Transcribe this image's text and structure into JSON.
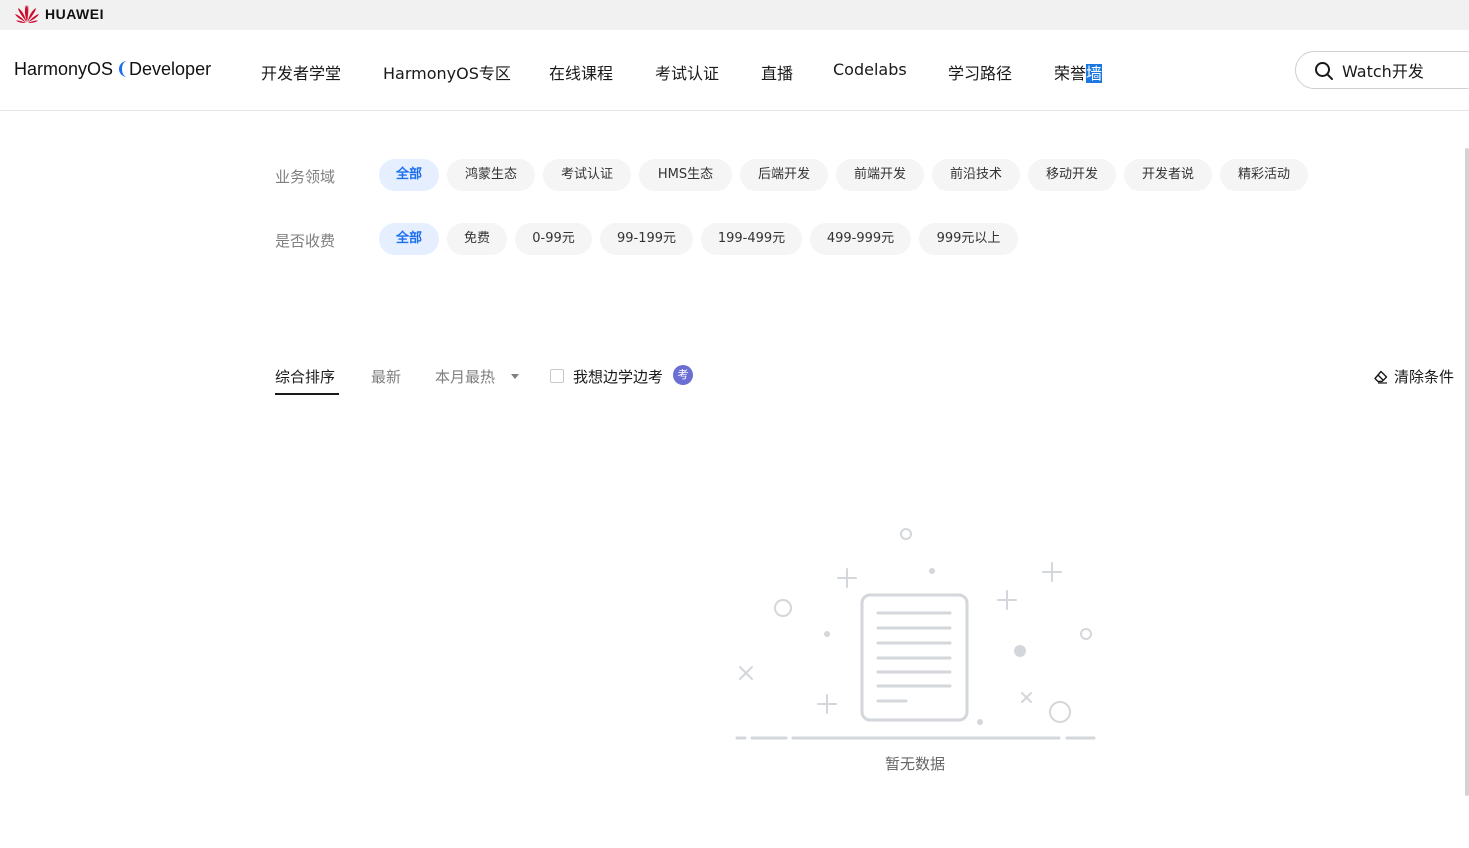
{
  "topbar": {
    "brand": "HUAWEI"
  },
  "navbar": {
    "brand_prefix": "HarmonyOS",
    "brand_suffix": "Developer",
    "items": [
      "开发者学堂",
      "HarmonyOS专区",
      "在线课程",
      "考试认证",
      "直播",
      "Codelabs",
      "学习路径"
    ],
    "last_item_prefix": "荣誉",
    "last_item_selected": "墙",
    "search": {
      "value": "Watch开发",
      "icon": "search-icon"
    }
  },
  "filters": {
    "domain": {
      "label": "业务领域",
      "options": [
        "全部",
        "鸿蒙生态",
        "考试认证",
        "HMS生态",
        "后端开发",
        "前端开发",
        "前沿技术",
        "移动开发",
        "开发者说",
        "精彩活动"
      ],
      "selected": "全部"
    },
    "fee": {
      "label": "是否收费",
      "options": [
        "全部",
        "免费",
        "0-99元",
        "99-199元",
        "199-499元",
        "499-999元",
        "999元以上"
      ],
      "selected": "全部"
    }
  },
  "sort": {
    "tabs": [
      "综合排序",
      "最新",
      "本月最热"
    ],
    "active": "综合排序",
    "checkbox_label": "我想边学边考",
    "checkbox_checked": false,
    "badge": "考",
    "clear_label": "清除条件"
  },
  "empty": {
    "text": "暂无数据"
  },
  "colors": {
    "accent": "#1d6ff2",
    "chip_active_bg": "#e5efff",
    "chip_bg": "#f5f5f5",
    "badge": "#6b6fd4",
    "brand_red": "#cf0a2c"
  }
}
